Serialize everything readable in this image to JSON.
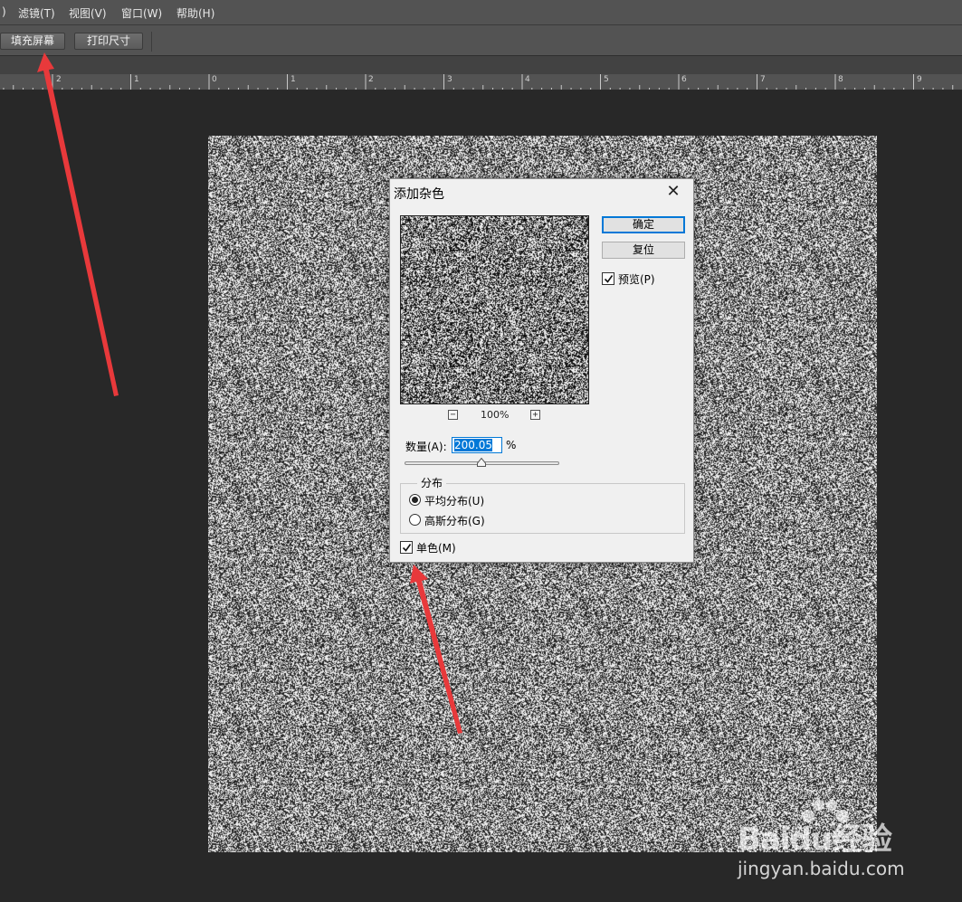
{
  "menubar": {
    "items": [
      {
        "label": ")"
      },
      {
        "label": "滤镜(T)"
      },
      {
        "label": "视图(V)"
      },
      {
        "label": "窗口(W)"
      },
      {
        "label": "帮助(H)"
      }
    ]
  },
  "options_bar": {
    "fill_screen_label": "填充屏幕",
    "print_size_label": "打印尺寸"
  },
  "ruler": {
    "labels": [
      "2",
      "1",
      "0",
      "1",
      "2",
      "3",
      "4",
      "5",
      "6",
      "7",
      "8",
      "9"
    ]
  },
  "dialog": {
    "title": "添加杂色",
    "close_glyph": "✕",
    "ok_label": "确定",
    "reset_label": "复位",
    "preview_label": "预览(P)",
    "preview_checked": true,
    "zoom_minus": "−",
    "zoom_plus": "+",
    "zoom_level": "100%",
    "amount_label": "数量(A):",
    "amount_value": "200.05",
    "amount_unit": "%",
    "distribution_legend": "分布",
    "uniform_label": "平均分布(U)",
    "gaussian_label": "高斯分布(G)",
    "selected_distribution": "uniform",
    "monochromatic_label": "单色(M)",
    "monochromatic_checked": true
  },
  "watermark": {
    "brand": "Baidu经验",
    "url": "jingyan.baidu.com"
  },
  "colors": {
    "arrow": "#e8393b",
    "accent": "#0078d7",
    "panel": "#535353",
    "workspace": "#282828"
  }
}
